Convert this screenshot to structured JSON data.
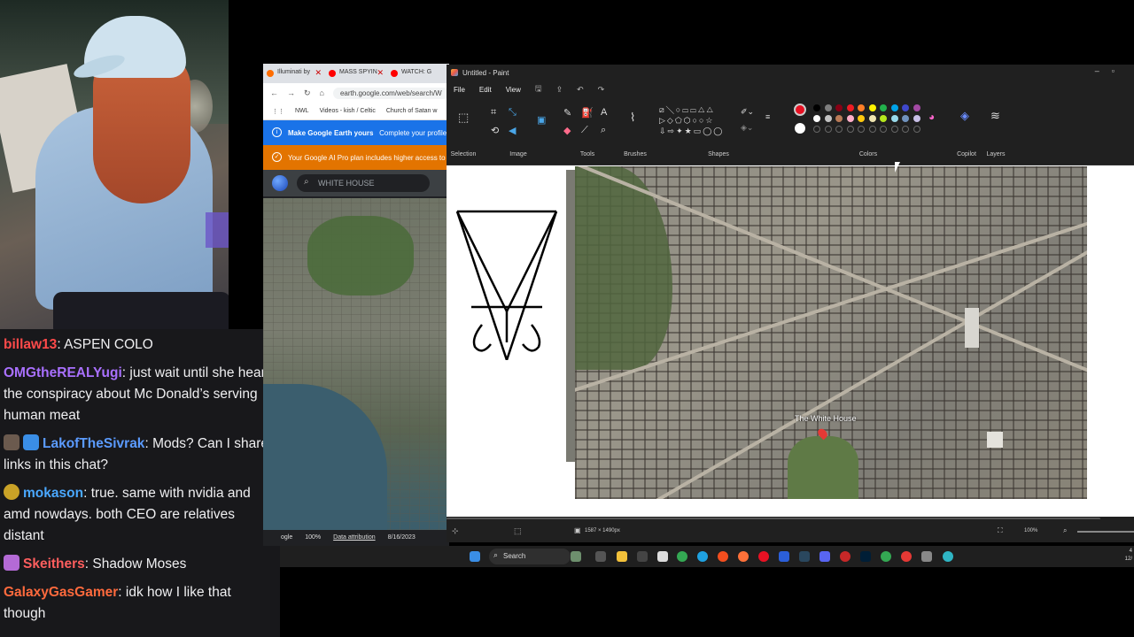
{
  "chat": {
    "messages": [
      {
        "user": "billaw13",
        "text": "ASPEN COLO",
        "color": "#ff4a4a"
      },
      {
        "user": "OMGtheREALYugi",
        "text": "just wait until she hears the conspiracy about Mc Donald’s serving human meat",
        "color": "#a970ff"
      },
      {
        "user": "LakofTheSivrak",
        "text": "Mods? Can I share links in this chat?",
        "color": "#5b9bff"
      },
      {
        "user": "mokason",
        "text": "true. same with nvidia and amd nowdays. both CEO are relatives distant",
        "color": "#4aa8ff"
      },
      {
        "user": "Skeithers",
        "text": "Shadow Moses",
        "color": "#ff5e5e"
      },
      {
        "user": "GalaxyGasGamer",
        "text": "idk how I like that though",
        "color": "#ff6a3d"
      }
    ]
  },
  "browser": {
    "tabs": [
      {
        "label": "Illuminati by",
        "color": "#ff6d00"
      },
      {
        "label": "MASS SPYIN",
        "color": "#ff0000"
      },
      {
        "label": "WATCH: G",
        "color": "#ff0000"
      }
    ],
    "url": "earth.google.com/web/search/W",
    "bookmarks": [
      "NWL",
      "Videos - kish / Celtic",
      "Church of Satan w"
    ],
    "banner1": "Make Google Earth yours",
    "banner1_sub": "Complete your profile to",
    "banner2": "Your Google AI Pro plan includes higher access to A",
    "search_value": "WHITE HOUSE",
    "footer": {
      "brand": "ogle",
      "zoom": "100%",
      "attribution": "Data attribution",
      "date": "8/16/2023"
    }
  },
  "paint": {
    "title": "Untitled - Paint",
    "menu": [
      "File",
      "Edit",
      "View"
    ],
    "groups": [
      "Selection",
      "Image",
      "Tools",
      "Brushes",
      "Shapes",
      "Colors",
      "Copilot",
      "Layers"
    ],
    "map_label": "The White House",
    "status_dims": "1587 × 1490px",
    "zoom": "100%",
    "palette_row1": [
      "#000000",
      "#7f7f7f",
      "#880015",
      "#ed1c24",
      "#ff7f27",
      "#fff200",
      "#22b14c",
      "#00a2e8",
      "#3f48cc",
      "#a349a4"
    ],
    "palette_row2": [
      "#ffffff",
      "#c3c3c3",
      "#b97a57",
      "#ffaec9",
      "#ffc90e",
      "#efe4b0",
      "#b5e61d",
      "#99d9ea",
      "#7092be",
      "#c8bfe7"
    ],
    "primary_color": "#e81123"
  },
  "taskbar": {
    "search": "Search",
    "clock_line1": "4",
    "clock_line2": "12/"
  }
}
